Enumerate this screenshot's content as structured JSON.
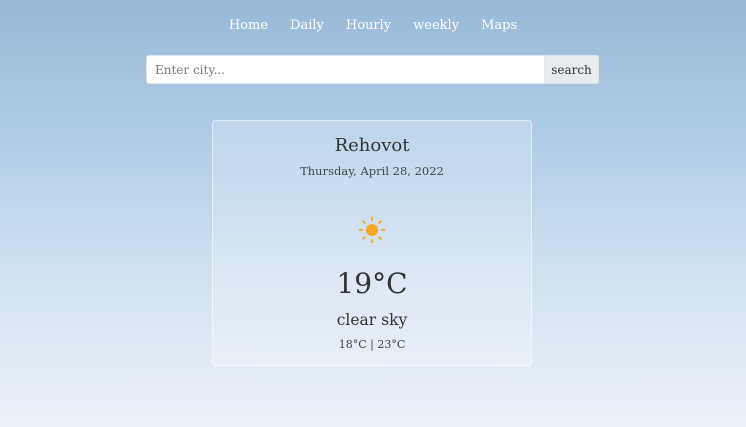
{
  "nav": {
    "items": [
      {
        "label": "Home"
      },
      {
        "label": "Daily"
      },
      {
        "label": "Hourly"
      },
      {
        "label": "weekly"
      },
      {
        "label": "Maps"
      }
    ]
  },
  "search": {
    "placeholder": "Enter city...",
    "value": "",
    "button_label": "search"
  },
  "weather": {
    "city": "Rehovot",
    "date": "Thursday, April 28, 2022",
    "icon": "sun-icon",
    "temperature": "19°C",
    "description": "clear sky",
    "range": "18°C | 23°C"
  },
  "colors": {
    "sun": "#f5a623",
    "background_top": "#98b9da",
    "background_bottom": "#eaf1f8"
  }
}
